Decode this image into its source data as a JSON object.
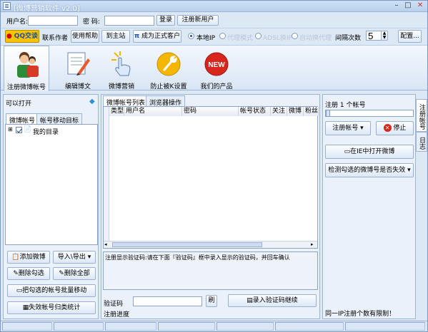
{
  "window": {
    "title": "[微博营销软件 v2.0]"
  },
  "login": {
    "username_label": "用户名:",
    "username_value": "",
    "password_label": "密  码:",
    "password_value": "",
    "login_button": "登录",
    "register_button": "注册新用户"
  },
  "topbar": {
    "qq_button": "QQ交谈",
    "contact_author": "联系作者",
    "help": "使用帮助",
    "home": "到主站",
    "upgrade": "成为正式客户",
    "ip_local": "本地IP",
    "ip_opt2": "代理模式",
    "ip_opt3": "ADSL换IP",
    "ip_opt4": "自动换代理",
    "interval_label": "间隔次数",
    "interval_value": "5",
    "config_button": "配置..."
  },
  "toolbar": {
    "items": [
      {
        "label": "注册微博帐号"
      },
      {
        "label": "编辑博文"
      },
      {
        "label": "微博营销"
      },
      {
        "label": "防止被K设置"
      },
      {
        "label": "我们的产品"
      }
    ]
  },
  "left": {
    "open_label": "可以打开",
    "tabs": [
      "微博帐号",
      "帐号移动目标"
    ],
    "tree_item": "我的目录",
    "btn_add": "添加微博",
    "btn_import": "导入\\导出",
    "btn_del_checked": "删除勾选",
    "btn_del_all": "删除全部",
    "btn_move": "把勾选的帐号批量移动",
    "btn_stats": "失效帐号归类统计"
  },
  "center": {
    "tabs": [
      "微博帐号列表",
      "浏览器操作"
    ],
    "columns": [
      "类型",
      "用户名",
      "密码",
      "帐号状态",
      "关注",
      "微博",
      "粉丝"
    ],
    "captcha_hint": "注册显示验证码:请在下面『验证码』框中录入显示的验证码，并回车确认",
    "captcha_label": "验证码",
    "captcha_value": "",
    "refresh_button": "刷",
    "captcha_submit": "录入验证码继续",
    "progress_label": "注册进度"
  },
  "right": {
    "title": "注册 1 个帐号",
    "slider_percent": 0,
    "register_button": "注册帐号",
    "stop_button": "停止",
    "open_ie": "在IE中打开微博",
    "check_invalid": "检测勾选的微博号是否失效",
    "note": "同一IP注册个数有限制！",
    "vtab1": "注册帐号",
    "vtab2": "日志"
  },
  "colors": {
    "accent": "#1e4ea0",
    "window_bg": "#dde8f5",
    "border": "#9db4d6"
  }
}
